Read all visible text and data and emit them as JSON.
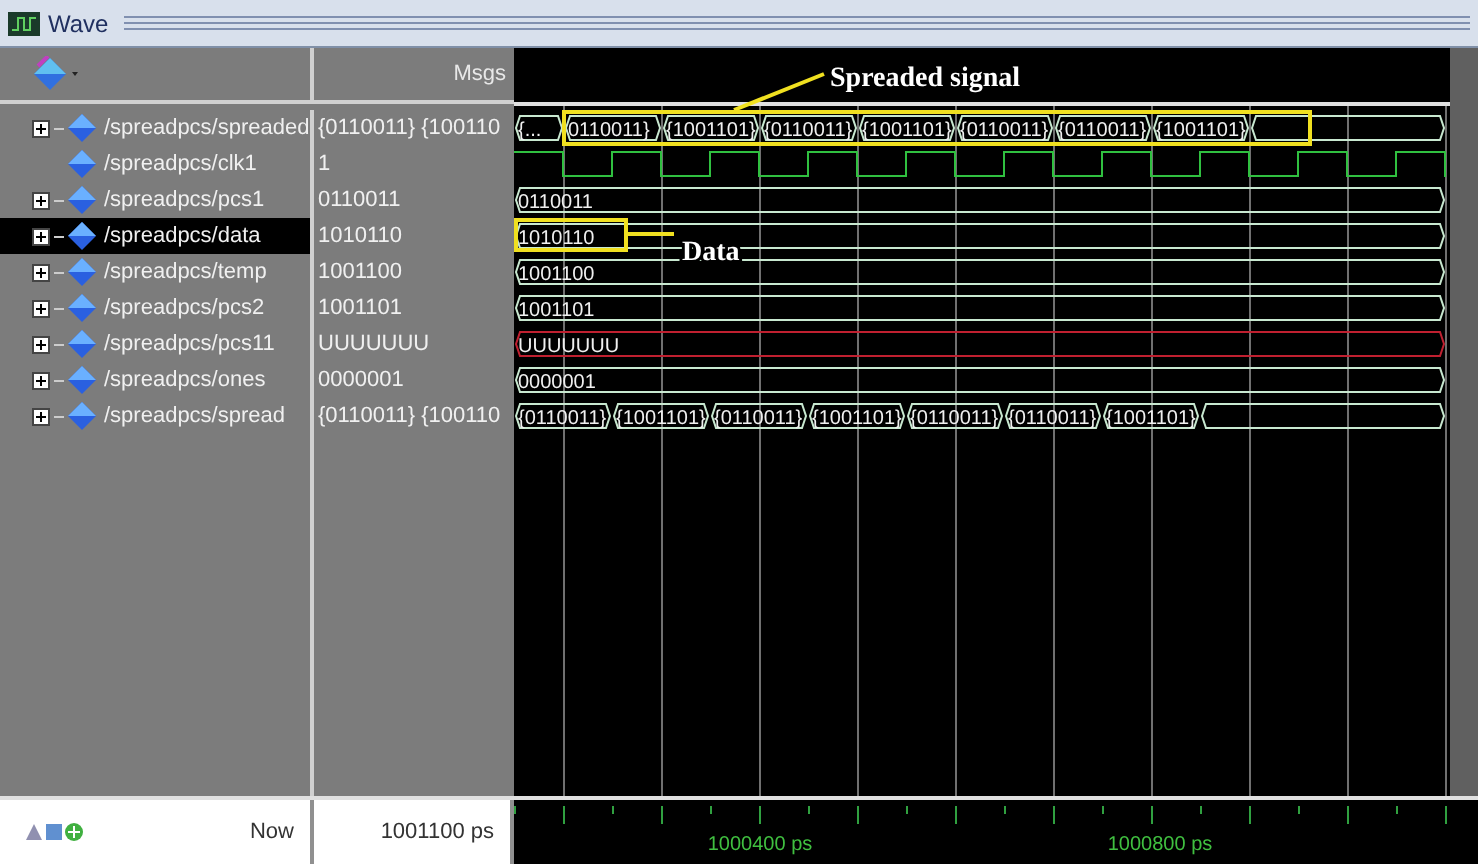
{
  "window": {
    "title": "Wave"
  },
  "header": {
    "msgs_label": "Msgs"
  },
  "signals": [
    {
      "name": "/spreadpcs/spreaded",
      "value": "{0110011} {100110",
      "expandable": true,
      "selected": false,
      "kind": "bus",
      "leading_partial": true,
      "segments": [
        "{...",
        "0110011}",
        "{1001101}",
        "{0110011}",
        "{1001101}",
        "{0110011}",
        "{0110011}",
        "{1001101}"
      ],
      "annotation": "Spreaded signal"
    },
    {
      "name": "/spreadpcs/clk1",
      "value": "1",
      "expandable": false,
      "selected": false,
      "kind": "clock"
    },
    {
      "name": "/spreadpcs/pcs1",
      "value": "0110011",
      "expandable": true,
      "selected": false,
      "kind": "bus",
      "leading_partial": false,
      "segments": [
        "0110011"
      ]
    },
    {
      "name": "/spreadpcs/data",
      "value": "1010110",
      "expandable": true,
      "selected": true,
      "kind": "bus",
      "leading_partial": false,
      "segments": [
        "1010110"
      ],
      "annotation": "Data"
    },
    {
      "name": "/spreadpcs/temp",
      "value": "1001100",
      "expandable": true,
      "selected": false,
      "kind": "bus",
      "leading_partial": false,
      "segments": [
        "1001100"
      ]
    },
    {
      "name": "/spreadpcs/pcs2",
      "value": "1001101",
      "expandable": true,
      "selected": false,
      "kind": "bus",
      "leading_partial": false,
      "segments": [
        "1001101"
      ]
    },
    {
      "name": "/spreadpcs/pcs11",
      "value": "UUUUUUU",
      "expandable": true,
      "selected": false,
      "kind": "undefined",
      "leading_partial": false,
      "segments": [
        "UUUUUUU"
      ]
    },
    {
      "name": "/spreadpcs/ones",
      "value": "0000001",
      "expandable": true,
      "selected": false,
      "kind": "bus",
      "leading_partial": false,
      "segments": [
        "0000001"
      ]
    },
    {
      "name": "/spreadpcs/spread",
      "value": "{0110011} {100110",
      "expandable": true,
      "selected": false,
      "kind": "bus",
      "leading_partial": false,
      "segments": [
        "{0110011}",
        "{1001101}",
        "{0110011}",
        "{1001101}",
        "{0110011}",
        "{0110011}",
        "{1001101}"
      ]
    }
  ],
  "footer": {
    "now_label": "Now",
    "now_value": "1001100 ps",
    "time_labels": [
      "1000400 ps",
      "1000800 ps"
    ]
  }
}
